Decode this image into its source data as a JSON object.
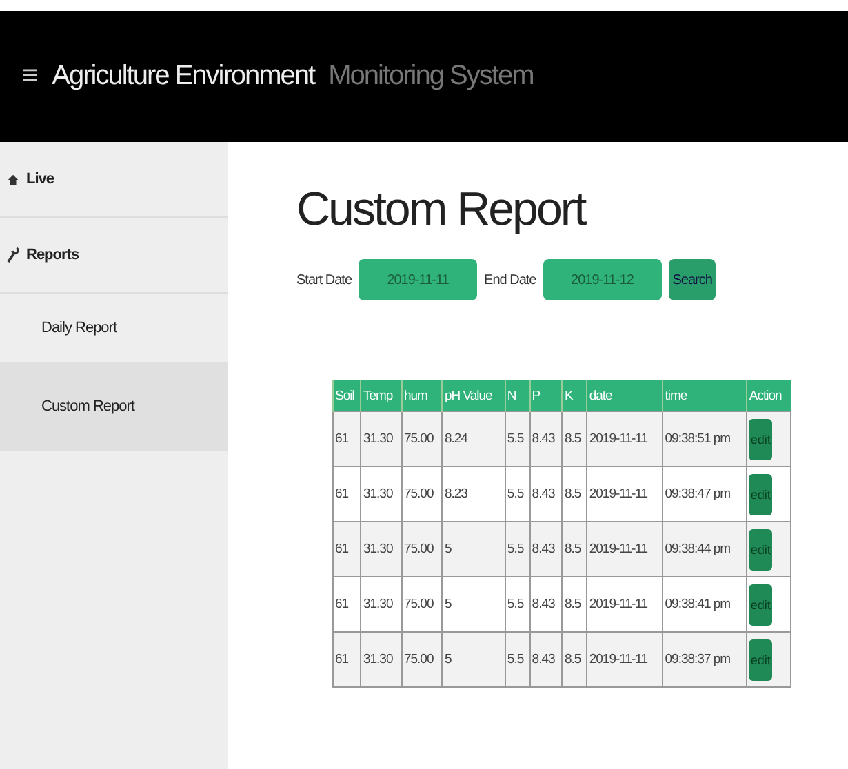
{
  "header": {
    "menu_icon": "≡",
    "title": "Agriculture Environment",
    "subtitle": "Monitoring System"
  },
  "sidebar": {
    "items": [
      {
        "label": "Live",
        "selected": false,
        "kind": "section"
      },
      {
        "label": "Reports",
        "selected": false,
        "kind": "section"
      },
      {
        "label": "Daily Report",
        "selected": false,
        "kind": "sub"
      },
      {
        "label": "Custom Report",
        "selected": true,
        "kind": "sub"
      }
    ]
  },
  "page_title": "Custom Report",
  "filter": {
    "start_label": "Start Date",
    "start_value": "2019-11-11",
    "end_label": "End Date",
    "end_value": "2019-11-12",
    "search_button": "Search"
  },
  "table": {
    "columns": [
      "Soil",
      "Temp",
      "hum",
      "pH Value",
      "N",
      "P",
      "K",
      "date",
      "time",
      "Action"
    ],
    "rows": [
      {
        "cells": [
          "61",
          "31.30",
          "75.00",
          "8.24",
          "5.5",
          "8.43",
          "8.5",
          "2019-11-11",
          "09:38:51 pm"
        ],
        "action": "edit"
      },
      {
        "cells": [
          "61",
          "31.30",
          "75.00",
          "8.23",
          "5.5",
          "8.43",
          "8.5",
          "2019-11-11",
          "09:38:47 pm"
        ],
        "action": "edit"
      },
      {
        "cells": [
          "61",
          "31.30",
          "75.00",
          "5",
          "5.5",
          "8.43",
          "8.5",
          "2019-11-11",
          "09:38:44 pm"
        ],
        "action": "edit"
      },
      {
        "cells": [
          "61",
          "31.30",
          "75.00",
          "5",
          "5.5",
          "8.43",
          "8.5",
          "2019-11-11",
          "09:38:41 pm"
        ],
        "action": "edit"
      },
      {
        "cells": [
          "61",
          "31.30",
          "75.00",
          "5",
          "5.5",
          "8.43",
          "8.5",
          "2019-11-11",
          "09:38:37 pm"
        ],
        "action": "edit"
      }
    ]
  }
}
